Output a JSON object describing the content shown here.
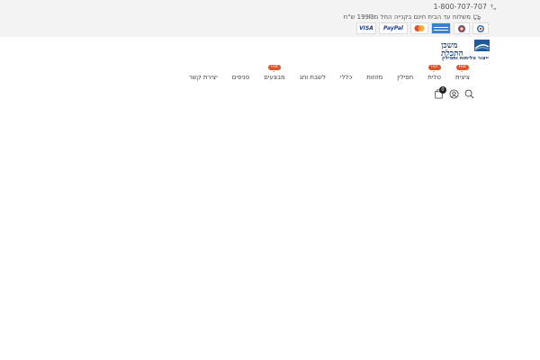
{
  "header": {
    "phone": "1-800-707-707",
    "shipping_text": "משלוח עד הבית חינם בקנייה החל מ199₪ ש\"ח",
    "payment_cards": [
      {
        "name": "visa",
        "label": "VISA"
      },
      {
        "name": "paypal",
        "label": "PayPal"
      },
      {
        "name": "mastercard",
        "label": ""
      },
      {
        "name": "amex",
        "label": ""
      },
      {
        "name": "diners",
        "label": ""
      },
      {
        "name": "isracard",
        "label": ""
      }
    ]
  },
  "logo": {
    "tagline": "ייצור טליתות ותפילין"
  },
  "nav": {
    "items": [
      {
        "label": "ציצית",
        "hot": true
      },
      {
        "label": "טלית",
        "hot": true
      },
      {
        "label": "תפילין",
        "hot": false
      },
      {
        "label": "מזוזות",
        "hot": false
      },
      {
        "label": "כללי",
        "hot": false
      },
      {
        "label": "לשבת וחג",
        "hot": false
      },
      {
        "label": "מבצעים",
        "hot": true
      },
      {
        "label": "סניפים",
        "hot": false
      },
      {
        "label": "יצירת קשר",
        "hot": false
      }
    ],
    "hot_label": "Hot"
  },
  "icons": {
    "cart_count": "0"
  },
  "colors": {
    "accent": "#1b4c8a",
    "hot": "#e2512a",
    "topbar": "#f3f3f3"
  }
}
